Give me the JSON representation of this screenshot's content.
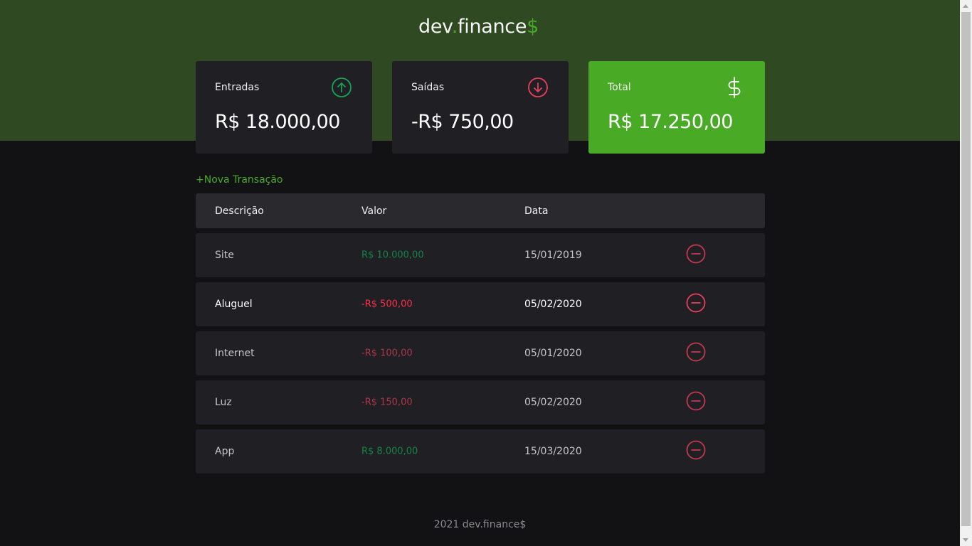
{
  "app": {
    "logo_main": "dev",
    "logo_dot": ".",
    "logo_rest": "finance",
    "logo_dollar": "$",
    "brand_color": "#49aa26"
  },
  "cards": [
    {
      "label": "Entradas",
      "value": "R$ 18.000,00",
      "icon": "arrow-up-circle-icon"
    },
    {
      "label": "Saídas",
      "value": "-R$ 750,00",
      "icon": "arrow-down-circle-icon"
    },
    {
      "label": "Total",
      "value": "R$ 17.250,00",
      "icon": "dollar-sign-icon"
    }
  ],
  "new_transaction_label": "+Nova Transação",
  "table": {
    "headers": [
      "Descrição",
      "Valor",
      "Data"
    ],
    "rows": [
      {
        "description": "Site",
        "amount": "R$ 10.000,00",
        "date": "15/01/2019"
      },
      {
        "description": "Aluguel",
        "amount": "-R$ 500,00",
        "date": "05/02/2020"
      },
      {
        "description": "Internet",
        "amount": "-R$ 100,00",
        "date": "05/01/2020"
      },
      {
        "description": "Luz",
        "amount": "-R$ 150,00",
        "date": "05/02/2020"
      },
      {
        "description": "App",
        "amount": "R$ 8.000,00",
        "date": "15/03/2020"
      }
    ]
  },
  "footer": "2021 dev.finance$",
  "colors": {
    "income": "#12a454",
    "expense": "#e83f5b",
    "header_bg": "#2f4a23",
    "card_bg": "#202024"
  }
}
